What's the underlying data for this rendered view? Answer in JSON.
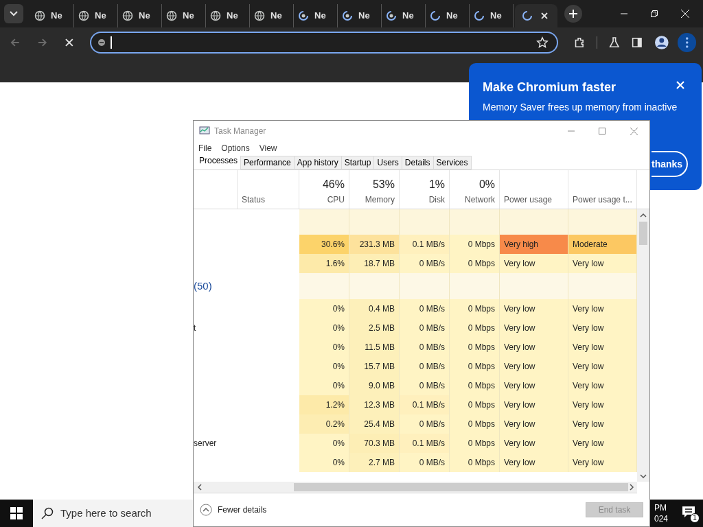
{
  "browser": {
    "tabs": [
      {
        "title": "Ne",
        "kind": "globe",
        "selected": false
      },
      {
        "title": "Ne",
        "kind": "globe",
        "selected": false
      },
      {
        "title": "Ne",
        "kind": "globe",
        "selected": false
      },
      {
        "title": "Ne",
        "kind": "globe",
        "selected": false
      },
      {
        "title": "Ne",
        "kind": "globe",
        "selected": false
      },
      {
        "title": "Ne",
        "kind": "globe",
        "selected": false
      },
      {
        "title": "Ne",
        "kind": "swirl",
        "selected": false
      },
      {
        "title": "Ne",
        "kind": "swirl",
        "selected": false
      },
      {
        "title": "Ne",
        "kind": "swirl",
        "selected": false
      },
      {
        "title": "Ne",
        "kind": "loading",
        "selected": false
      },
      {
        "title": "Ne",
        "kind": "loading",
        "selected": false
      },
      {
        "kind": "loading",
        "selected": true
      }
    ],
    "popup": {
      "title": "Make Chromium faster",
      "body": "Memory Saver frees up memory from inactive",
      "button": "thanks"
    }
  },
  "task_manager": {
    "title": "Task Manager",
    "menu": [
      "File",
      "Options",
      "View"
    ],
    "tabs": [
      {
        "label": "Processes",
        "selected": true
      },
      {
        "label": "Performance",
        "selected": false
      },
      {
        "label": "App history",
        "selected": false
      },
      {
        "label": "Startup",
        "selected": false
      },
      {
        "label": "Users",
        "selected": false
      },
      {
        "label": "Details",
        "selected": false
      },
      {
        "label": "Services",
        "selected": false
      }
    ],
    "columns": [
      {
        "label": "Status"
      },
      {
        "percent": "46%",
        "label": "CPU"
      },
      {
        "percent": "53%",
        "label": "Memory"
      },
      {
        "percent": "1%",
        "label": "Disk"
      },
      {
        "percent": "0%",
        "label": "Network"
      },
      {
        "label": "Power usage"
      },
      {
        "label": "Power usage t..."
      }
    ],
    "rows": [
      {
        "kind": "blank"
      },
      {
        "kind": "process",
        "cells": [
          {
            "text": "30.6%",
            "color": "#fcd36a"
          },
          {
            "text": "231.3 MB",
            "color": "#fde29c"
          },
          {
            "text": "0.1 MB/s",
            "color": "#fff0bd"
          },
          {
            "text": "0 Mbps",
            "color": "#fff4c4"
          },
          {
            "text": "Very high",
            "color": "#f78a4a"
          },
          {
            "text": "Moderate",
            "color": "#fcc862"
          }
        ]
      },
      {
        "kind": "process",
        "cells": [
          {
            "text": "1.6%",
            "color": "#fdeaa9"
          },
          {
            "text": "18.7 MB",
            "color": "#fdeeb5"
          },
          {
            "text": "0 MB/s",
            "color": "#fff4c4"
          },
          {
            "text": "0 Mbps",
            "color": "#fff4c4"
          },
          {
            "text": "Very low",
            "color": "#fff4c4"
          },
          {
            "text": "Very low",
            "color": "#fff4c4"
          }
        ]
      },
      {
        "kind": "group",
        "name": "(50)"
      },
      {
        "kind": "process",
        "cells": [
          {
            "text": "0%",
            "color": "#fff4c4"
          },
          {
            "text": "0.4 MB",
            "color": "#fdf0ba"
          },
          {
            "text": "0 MB/s",
            "color": "#fff4c4"
          },
          {
            "text": "0 Mbps",
            "color": "#fff4c4"
          },
          {
            "text": "Very low",
            "color": "#fff4c4"
          },
          {
            "text": "Very low",
            "color": "#fff4c4"
          }
        ]
      },
      {
        "kind": "process",
        "name": "t",
        "cells": [
          {
            "text": "0%",
            "color": "#fff4c4"
          },
          {
            "text": "2.5 MB",
            "color": "#fdf0ba"
          },
          {
            "text": "0 MB/s",
            "color": "#fff4c4"
          },
          {
            "text": "0 Mbps",
            "color": "#fff4c4"
          },
          {
            "text": "Very low",
            "color": "#fff4c4"
          },
          {
            "text": "Very low",
            "color": "#fff4c4"
          }
        ]
      },
      {
        "kind": "process",
        "cells": [
          {
            "text": "0%",
            "color": "#fff4c4"
          },
          {
            "text": "11.5 MB",
            "color": "#fdf0ba"
          },
          {
            "text": "0 MB/s",
            "color": "#fff4c4"
          },
          {
            "text": "0 Mbps",
            "color": "#fff4c4"
          },
          {
            "text": "Very low",
            "color": "#fff4c4"
          },
          {
            "text": "Very low",
            "color": "#fff4c4"
          }
        ]
      },
      {
        "kind": "process",
        "cells": [
          {
            "text": "0%",
            "color": "#fff4c4"
          },
          {
            "text": "15.7 MB",
            "color": "#fdf0ba"
          },
          {
            "text": "0 MB/s",
            "color": "#fff4c4"
          },
          {
            "text": "0 Mbps",
            "color": "#fff4c4"
          },
          {
            "text": "Very low",
            "color": "#fff4c4"
          },
          {
            "text": "Very low",
            "color": "#fff4c4"
          }
        ]
      },
      {
        "kind": "process",
        "cells": [
          {
            "text": "0%",
            "color": "#fff4c4"
          },
          {
            "text": "9.0 MB",
            "color": "#fdf0ba"
          },
          {
            "text": "0 MB/s",
            "color": "#fff4c4"
          },
          {
            "text": "0 Mbps",
            "color": "#fff4c4"
          },
          {
            "text": "Very low",
            "color": "#fff4c4"
          },
          {
            "text": "Very low",
            "color": "#fff4c4"
          }
        ]
      },
      {
        "kind": "process",
        "cells": [
          {
            "text": "1.2%",
            "color": "#fdeaa9"
          },
          {
            "text": "12.3 MB",
            "color": "#fdf0ba"
          },
          {
            "text": "0.1 MB/s",
            "color": "#fff0bd"
          },
          {
            "text": "0 Mbps",
            "color": "#fff4c4"
          },
          {
            "text": "Very low",
            "color": "#fff4c4"
          },
          {
            "text": "Very low",
            "color": "#fff4c4"
          }
        ]
      },
      {
        "kind": "process",
        "cells": [
          {
            "text": "0.2%",
            "color": "#fdedb2"
          },
          {
            "text": "25.4 MB",
            "color": "#fdf0ba"
          },
          {
            "text": "0 MB/s",
            "color": "#fff4c4"
          },
          {
            "text": "0 Mbps",
            "color": "#fff4c4"
          },
          {
            "text": "Very low",
            "color": "#fff4c4"
          },
          {
            "text": "Very low",
            "color": "#fff4c4"
          }
        ]
      },
      {
        "kind": "process",
        "name": "server",
        "cells": [
          {
            "text": "0%",
            "color": "#fff4c4"
          },
          {
            "text": "70.3 MB",
            "color": "#fdeeb5"
          },
          {
            "text": "0.1 MB/s",
            "color": "#fff0bd"
          },
          {
            "text": "0 Mbps",
            "color": "#fff4c4"
          },
          {
            "text": "Very low",
            "color": "#fff4c4"
          },
          {
            "text": "Very low",
            "color": "#fff4c4"
          }
        ]
      },
      {
        "kind": "process",
        "cells": [
          {
            "text": "0%",
            "color": "#fff4c4"
          },
          {
            "text": "2.7 MB",
            "color": "#fdf0ba"
          },
          {
            "text": "0 MB/s",
            "color": "#fff4c4"
          },
          {
            "text": "0 Mbps",
            "color": "#fff4c4"
          },
          {
            "text": "Very low",
            "color": "#fff4c4"
          },
          {
            "text": "Very low",
            "color": "#fff4c4"
          }
        ]
      }
    ],
    "footer": {
      "details": "Fewer details",
      "end_task": {
        "label": "End task",
        "disabled": true
      }
    }
  },
  "taskbar": {
    "search_placeholder": "Type here to search",
    "clock_time": "PM",
    "clock_date": "024",
    "notification_count": "1"
  }
}
